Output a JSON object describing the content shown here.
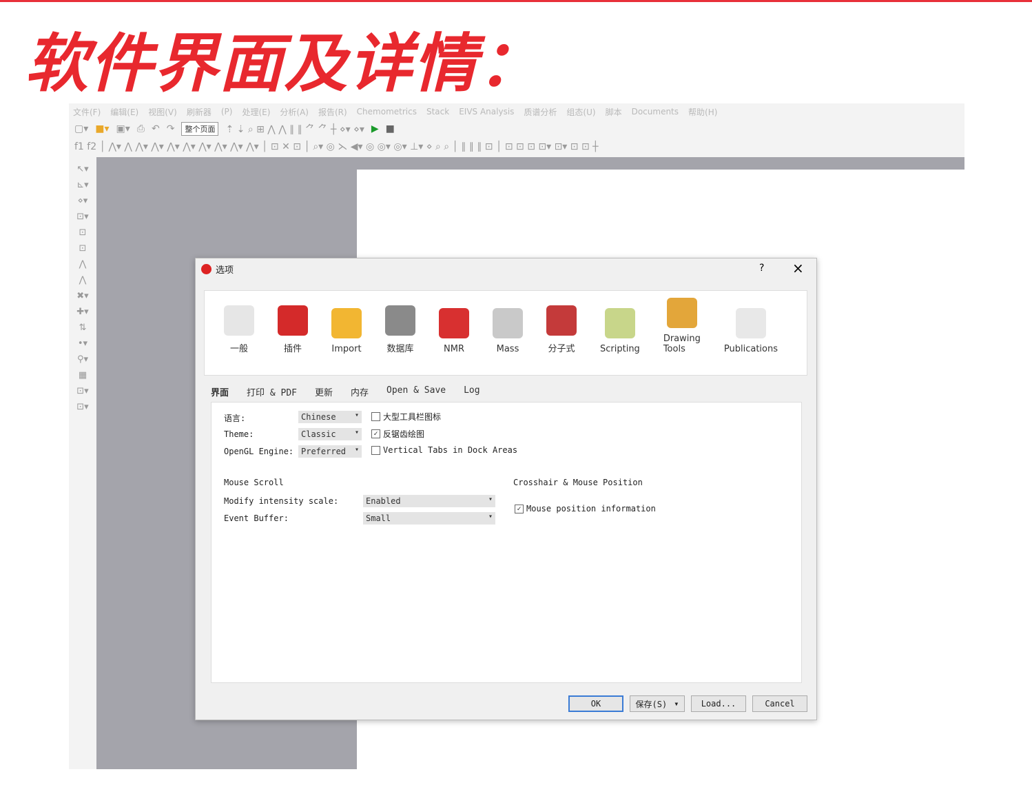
{
  "heading": "软件界面及详情：",
  "menu": [
    "文件(F)",
    "编辑(E)",
    "视图(V)",
    "刷新器",
    "(P)",
    "处理(E)",
    "分析(A)",
    "报告(R)",
    "Chemometrics",
    "Stack",
    "EIVS Analysis",
    "质谱分析",
    "组态(U)",
    "脚本",
    "Documents",
    "帮助(H)"
  ],
  "toolbar": {
    "zoom_select": "整个页面"
  },
  "dialog": {
    "title": "选项",
    "help": "?",
    "close": "×",
    "categories": [
      {
        "label": "一般",
        "color": "#e6e6e6"
      },
      {
        "label": "插件",
        "color": "#d42a2a"
      },
      {
        "label": "Import",
        "color": "#f2b632"
      },
      {
        "label": "数据库",
        "color": "#8a8a8a"
      },
      {
        "label": "NMR",
        "color": "#d83030"
      },
      {
        "label": "Mass",
        "color": "#c9c9c9"
      },
      {
        "label": "分子式",
        "color": "#c43a3a"
      },
      {
        "label": "Scripting",
        "color": "#c8d68a"
      },
      {
        "label": "Drawing Tools",
        "color": "#e3a63a"
      },
      {
        "label": "Publications",
        "color": "#e8e8e8"
      }
    ],
    "tabs": [
      "界面",
      "打印 & PDF",
      "更新",
      "内存",
      "Open & Save",
      "Log"
    ],
    "fields": {
      "language_label": "语言:",
      "language": "Chinese",
      "theme_label": "Theme:",
      "theme": "Classic",
      "opengl_label": "OpenGL Engine:",
      "opengl": "Preferred",
      "large_icons": "大型工具栏图标",
      "large_icons_checked": false,
      "antialias": "反锯齿绘图",
      "antialias_checked": true,
      "vertical_tabs": "Vertical Tabs in Dock Areas",
      "vertical_tabs_checked": false,
      "mouse_scroll": "Mouse Scroll",
      "modify_label": "Modify intensity scale:",
      "modify": "Enabled",
      "buffer_label": "Event Buffer:",
      "buffer": "Small",
      "crosshair": "Crosshair & Mouse Position",
      "mouse_pos": "Mouse position information",
      "mouse_pos_checked": true
    },
    "buttons": {
      "ok": "OK",
      "save": "保存(S)",
      "load": "Load...",
      "cancel": "Cancel"
    }
  }
}
